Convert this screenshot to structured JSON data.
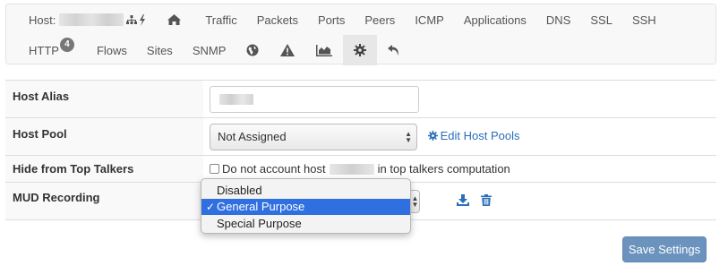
{
  "nav": {
    "host_label": "Host:",
    "row1": [
      "Traffic",
      "Packets",
      "Ports",
      "Peers",
      "ICMP",
      "Applications",
      "DNS",
      "SSL",
      "SSH"
    ],
    "http_label": "HTTP",
    "http_badge": "4",
    "row2": [
      "Flows",
      "Sites",
      "SNMP"
    ],
    "icons": [
      "network-tree-icon",
      "lightning-icon",
      "home-icon",
      "globe-icon",
      "warning-icon",
      "area-chart-icon",
      "gear-icon",
      "undo-icon"
    ]
  },
  "settings": {
    "host_alias": {
      "label": "Host Alias"
    },
    "host_pool": {
      "label": "Host Pool",
      "selected": "Not Assigned",
      "edit_link": "Edit Host Pools"
    },
    "top_talkers": {
      "label": "Hide from Top Talkers",
      "text_before": "Do not account host",
      "text_after": "in top talkers computation"
    },
    "mud_recording": {
      "label": "MUD Recording",
      "options": [
        "Disabled",
        "General Purpose",
        "Special Purpose"
      ],
      "selected_index": 1,
      "check_mark": "✓"
    }
  },
  "save_button": "Save Settings",
  "colors": {
    "link": "#2a6ebb",
    "highlight": "#2f6fe0",
    "save_button": "#6b93be",
    "badge": "#777777"
  }
}
